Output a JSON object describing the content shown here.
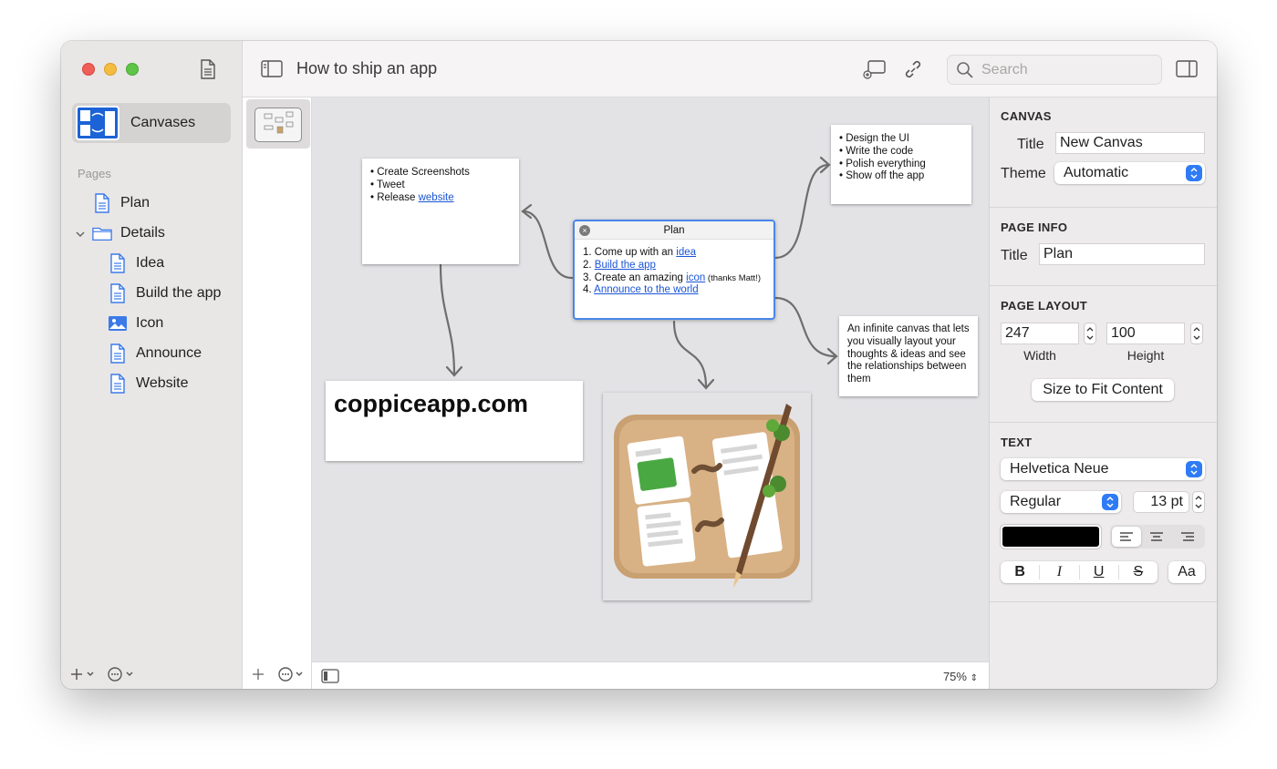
{
  "window": {
    "title": "How to ship an app"
  },
  "sidebar": {
    "canvases_label": "Canvases",
    "pages_header": "Pages",
    "items": [
      {
        "label": "Plan",
        "icon": "document-icon"
      },
      {
        "label": "Details",
        "icon": "folder-icon",
        "expanded": true
      },
      {
        "label": "Idea",
        "icon": "document-icon"
      },
      {
        "label": "Build the app",
        "icon": "document-icon"
      },
      {
        "label": "Icon",
        "icon": "image-icon"
      },
      {
        "label": "Announce",
        "icon": "document-icon"
      },
      {
        "label": "Website",
        "icon": "document-icon"
      }
    ]
  },
  "toolbar": {
    "search_placeholder": "Search"
  },
  "canvas": {
    "zoom": "75%",
    "screenshots_card": {
      "items": [
        "• Create Screenshots",
        "• Tweet",
        "• Release "
      ],
      "link": "website"
    },
    "plan_card": {
      "title": "Plan",
      "lines": [
        {
          "prefix": "1. Come up with an ",
          "link": "idea",
          "suffix": ""
        },
        {
          "prefix": "2. ",
          "link": "Build the app",
          "suffix": ""
        },
        {
          "prefix": "3. Create an amazing ",
          "link": "icon",
          "suffix": " (thanks Matt!)"
        },
        {
          "prefix": "4. ",
          "link": "Announce to the world",
          "suffix": ""
        }
      ]
    },
    "design_card": {
      "items": [
        "• Design the UI",
        "• Write the code",
        "• Polish everything",
        "• Show off the app"
      ]
    },
    "website_card": {
      "text": "coppiceapp.com"
    },
    "description_card": {
      "text": "An infinite canvas that lets you visually layout your thoughts & ideas and see the relationships between them"
    }
  },
  "inspector": {
    "canvas": {
      "header": "CANVAS",
      "title_label": "Title",
      "title_value": "New Canvas",
      "theme_label": "Theme",
      "theme_value": "Automatic"
    },
    "page_info": {
      "header": "PAGE INFO",
      "title_label": "Title",
      "title_value": "Plan"
    },
    "page_layout": {
      "header": "PAGE LAYOUT",
      "width_value": "247",
      "height_value": "100",
      "width_label": "Width",
      "height_label": "Height",
      "fit_button": "Size to Fit Content"
    },
    "text": {
      "header": "TEXT",
      "font": "Helvetica Neue",
      "style": "Regular",
      "size": "13 pt",
      "color": "#000000",
      "bold": "B",
      "italic": "I",
      "underline": "U",
      "strike": "S",
      "case": "Aa"
    }
  },
  "colors": {
    "accent": "#2f7bf5",
    "link": "#1a55d6",
    "selection": "#4a86e8"
  }
}
